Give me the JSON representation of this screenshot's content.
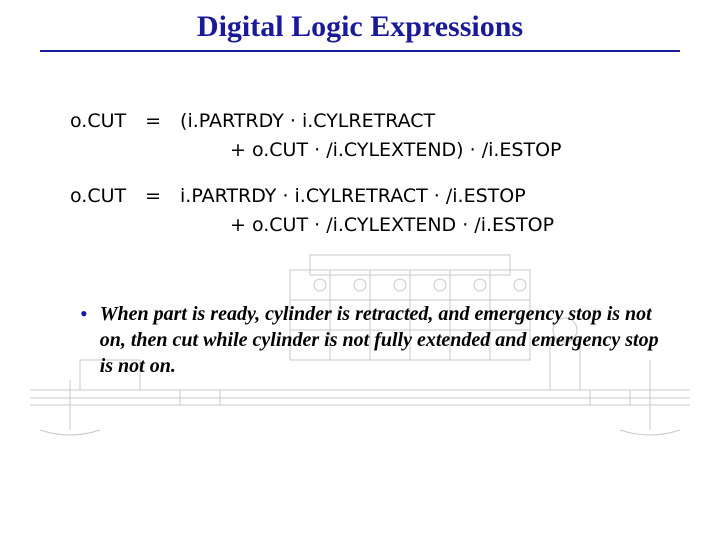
{
  "title": "Digital Logic Expressions",
  "expressions": {
    "line1": "o.CUT = (i.PARTRDY · i.CYLRETRACT",
    "line2": "+ o.CUT · /i.CYLEXTEND) · /i.ESTOP",
    "line3": "o.CUT = i.PARTRDY · i.CYLRETRACT · /i.ESTOP",
    "line4": "+ o.CUT · /i.CYLEXTEND · /i.ESTOP"
  },
  "bullet": {
    "dot": "•",
    "text": "When part is ready, cylinder is retracted, and emergency stop is not on, then cut while cylinder is not fully extended and emergency stop is not on."
  }
}
